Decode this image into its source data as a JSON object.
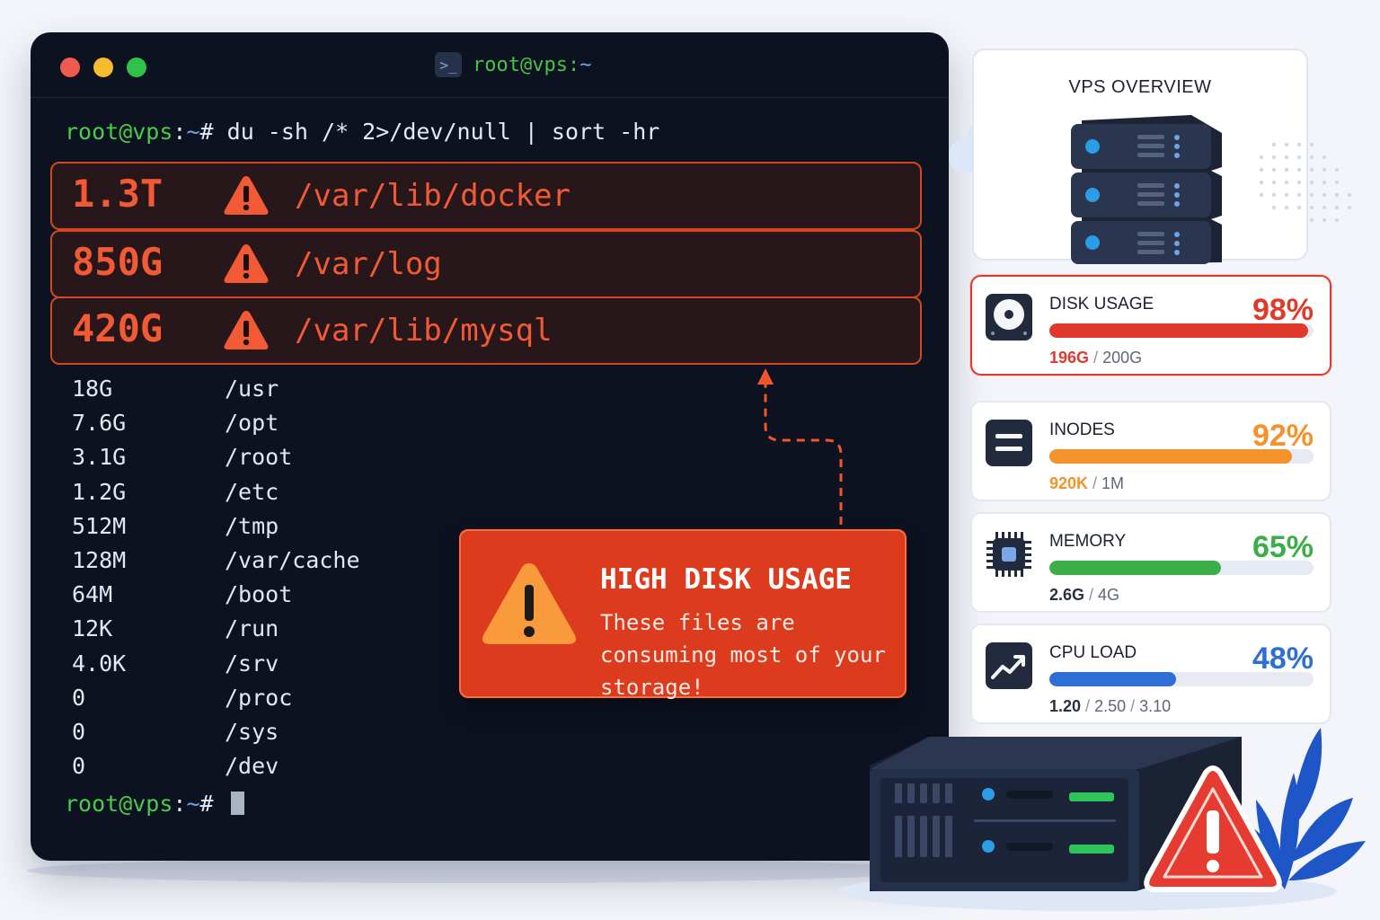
{
  "terminal": {
    "title_user": "root@vps:",
    "title_tilde": "~",
    "prompt_user": "root@vps",
    "prompt_colon": ":",
    "prompt_tilde": "~",
    "prompt_hash": "# ",
    "command": "du -sh /* 2>/dev/null | sort -hr",
    "highlighted": [
      {
        "size": "1.3T",
        "path": "/var/lib/docker"
      },
      {
        "size": "850G",
        "path": "/var/log"
      },
      {
        "size": "420G",
        "path": "/var/lib/mysql"
      }
    ],
    "rows": [
      {
        "size": "18G",
        "path": "/usr"
      },
      {
        "size": "7.6G",
        "path": "/opt"
      },
      {
        "size": "3.1G",
        "path": "/root"
      },
      {
        "size": "1.2G",
        "path": "/etc"
      },
      {
        "size": "512M",
        "path": "/tmp"
      },
      {
        "size": "128M",
        "path": "/var/cache"
      },
      {
        "size": "64M",
        "path": "/boot"
      },
      {
        "size": "12K",
        "path": "/run"
      },
      {
        "size": "4.0K",
        "path": "/srv"
      },
      {
        "size": "0",
        "path": "/proc"
      },
      {
        "size": "0",
        "path": "/sys"
      },
      {
        "size": "0",
        "path": "/dev"
      }
    ]
  },
  "alert": {
    "title": "HIGH DISK USAGE",
    "message": "These files are consuming most of your storage!"
  },
  "overview": {
    "title": "VPS OVERVIEW"
  },
  "metrics": [
    {
      "label": "DISK USAGE",
      "percent": "98%",
      "fraction": 0.98,
      "value": "196G",
      "rest": [
        "200G"
      ],
      "color": "#e03a2c",
      "value_color": "#e03a2c",
      "icon": "hard-disk-icon"
    },
    {
      "label": "INODES",
      "percent": "92%",
      "fraction": 0.92,
      "value": "920K",
      "rest": [
        "1M"
      ],
      "color": "#f5922b",
      "value_color": "#f5922b",
      "icon": "list-icon"
    },
    {
      "label": "MEMORY",
      "percent": "65%",
      "fraction": 0.65,
      "value": "2.6G",
      "rest": [
        "4G"
      ],
      "color": "#3cae49",
      "value_color": "#2b3040",
      "icon": "chip-icon"
    },
    {
      "label": "CPU LOAD",
      "percent": "48%",
      "fraction": 0.48,
      "value": "1.20",
      "rest": [
        "2.50",
        "3.10"
      ],
      "color": "#2e6fd6",
      "value_color": "#2b3040",
      "icon": "trend-chart-icon"
    }
  ],
  "colors": {
    "terminal_bg": "#0c1220",
    "danger": "#f25a36",
    "prompt_green": "#4cc94d",
    "prompt_blue": "#66a6f2"
  }
}
